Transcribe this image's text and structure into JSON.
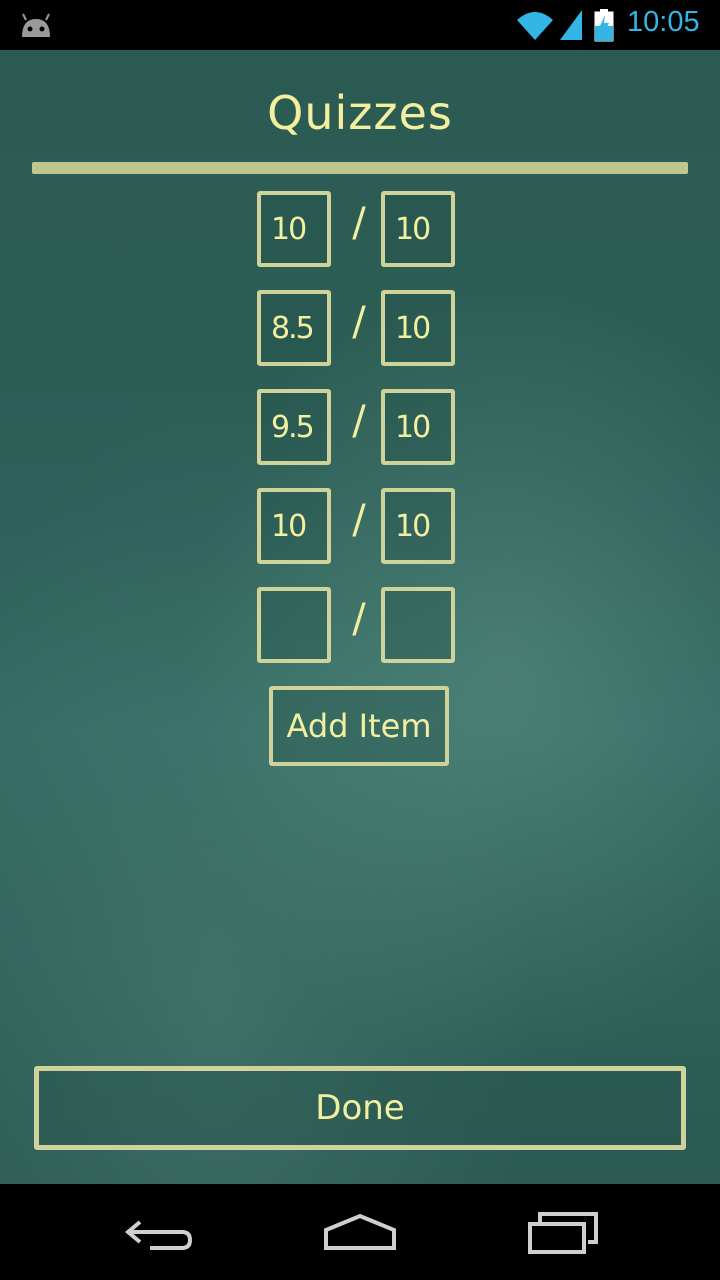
{
  "status_bar": {
    "time": "10:05",
    "icons": [
      "android-icon",
      "wifi-icon",
      "signal-icon",
      "battery-charging-icon"
    ],
    "accent_color": "#33b5e5"
  },
  "screen": {
    "title": "Quizzes",
    "rows": [
      {
        "score": "10",
        "separator": "/",
        "max": "10"
      },
      {
        "score": "8.5",
        "separator": "/",
        "max": "10"
      },
      {
        "score": "9.5",
        "separator": "/",
        "max": "10"
      },
      {
        "score": "10",
        "separator": "/",
        "max": "10"
      },
      {
        "score": "",
        "separator": "/",
        "max": ""
      }
    ],
    "add_item_label": "Add Item",
    "done_label": "Done",
    "chalk_color": "#f2f0a0",
    "board_color": "#2d6058"
  },
  "nav_bar": {
    "icons": [
      "back-icon",
      "home-icon",
      "recents-icon"
    ]
  }
}
